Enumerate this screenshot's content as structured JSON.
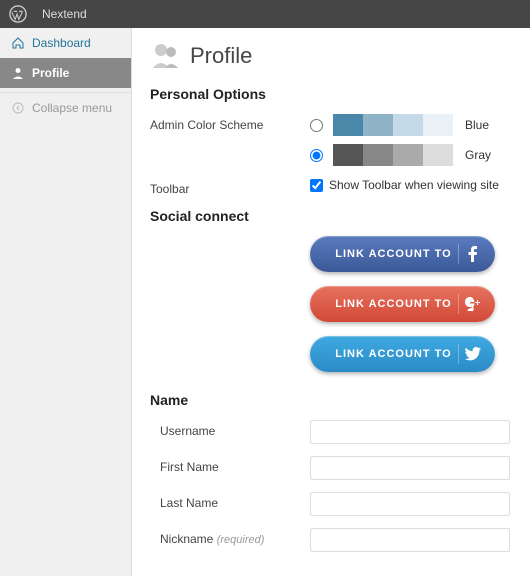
{
  "adminbar": {
    "site_name": "Nextend"
  },
  "sidebar": {
    "dashboard_label": "Dashboard",
    "profile_label": "Profile",
    "collapse_label": "Collapse menu"
  },
  "page": {
    "title": "Profile"
  },
  "sections": {
    "personal_options": "Personal Options",
    "social_connect": "Social connect",
    "name": "Name"
  },
  "fields": {
    "admin_color_scheme": "Admin Color Scheme",
    "toolbar_label": "Toolbar",
    "toolbar_show": "Show Toolbar when viewing site",
    "username": "Username",
    "first_name": "First Name",
    "last_name": "Last Name",
    "nickname": "Nickname",
    "required": "(required)"
  },
  "color_schemes": {
    "blue": {
      "name": "Blue",
      "selected": false,
      "swatches": [
        "#4a87a8",
        "#8fb3c7",
        "#c4dae8",
        "#eaf2f7"
      ]
    },
    "gray": {
      "name": "Gray",
      "selected": true,
      "swatches": [
        "#555",
        "#888",
        "#aaa",
        "#ddd"
      ]
    }
  },
  "toolbar_checked": true,
  "social": {
    "link_label": "LINK ACCOUNT TO"
  },
  "values": {
    "username": "",
    "first_name": "",
    "last_name": "",
    "nickname": ""
  }
}
